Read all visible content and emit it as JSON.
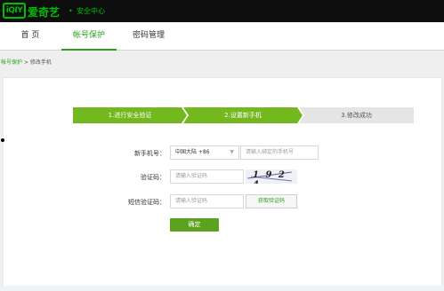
{
  "header": {
    "logo_text": "iQIY",
    "brand": "爱奇艺",
    "section": "安全中心",
    "brand_color": "#00be06"
  },
  "nav": {
    "home": "首 页",
    "account_protect": "帐号保护",
    "password_manage": "密码管理",
    "active_color": "#2b9f1e"
  },
  "breadcrumb": {
    "parent": "帐号保护",
    "separator": ">",
    "current": "修改手机"
  },
  "steps": [
    {
      "label": "1.进行安全验证",
      "state": "done"
    },
    {
      "label": "2.设置新手机",
      "state": "active"
    },
    {
      "label": "3.修改成功",
      "state": "pending"
    }
  ],
  "form": {
    "phone_label": "新手机号：",
    "country_value": "中国大陆 +86",
    "phone_placeholder": "请输入绑定的手机号",
    "captcha_label": "验证码：",
    "captcha_placeholder": "请输入验证码",
    "captcha_text": "1 9 2 4",
    "sms_label": "短信验证码：",
    "sms_placeholder": "请输入验证码",
    "sms_button": "获取验证码",
    "confirm_button": "确定"
  }
}
